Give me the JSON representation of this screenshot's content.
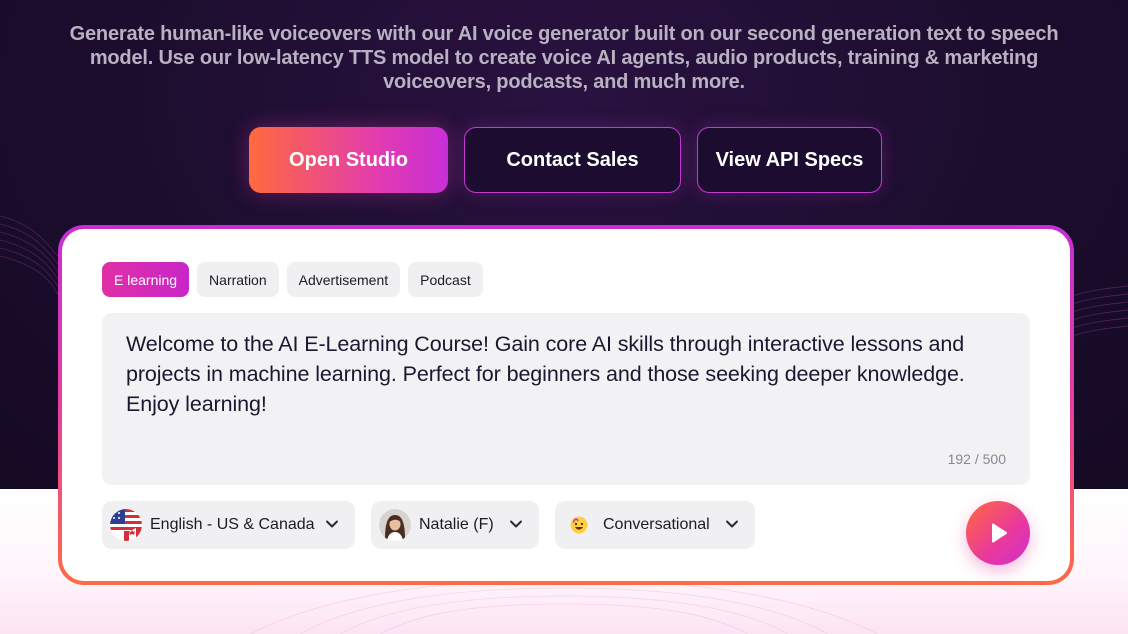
{
  "hero": {
    "subtitle": "Generate human-like voiceovers with our AI voice generator built on our second generation text to speech model. Use our low-latency TTS model to create voice AI agents, audio products, training & marketing voiceovers, podcasts, and much more."
  },
  "cta": {
    "primary_label": "Open Studio",
    "sales_label": "Contact Sales",
    "api_label": "View API Specs"
  },
  "demo": {
    "tabs": [
      {
        "label": "E learning",
        "active": true
      },
      {
        "label": "Narration",
        "active": false
      },
      {
        "label": "Advertisement",
        "active": false
      },
      {
        "label": "Podcast",
        "active": false
      }
    ],
    "text": "Welcome to the AI E-Learning Course! Gain core AI skills through interactive lessons and projects in machine learning. Perfect for beginners and those seeking deeper knowledge. Enjoy learning!",
    "char_count": "192 / 500",
    "language": {
      "label": "English - US & Canada",
      "icon": "us-canada-flag-icon"
    },
    "voice": {
      "label": "Natalie (F)",
      "icon": "natalie-avatar"
    },
    "style": {
      "label": "Conversational",
      "icon": "smiley-emoji-icon"
    },
    "play_icon": "play-icon"
  },
  "colors": {
    "hero_bg": "#1c0d2e",
    "accent_orange": "#ff6a3d",
    "accent_pink": "#e23bb0",
    "accent_purple": "#c72fd8"
  }
}
